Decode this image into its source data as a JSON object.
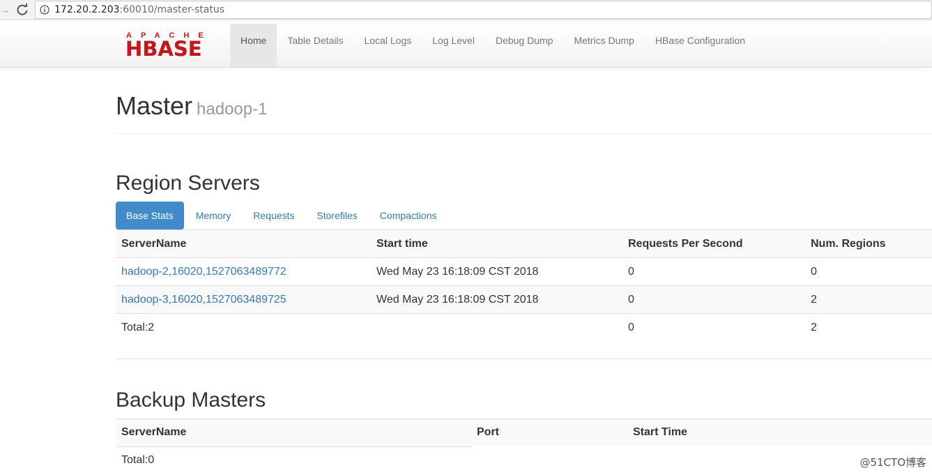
{
  "browser": {
    "url_host": "172.20.2.203",
    "url_rest": ":60010/master-status"
  },
  "logo": {
    "top": "APACHE",
    "main": "HBASE"
  },
  "nav": {
    "items": [
      {
        "label": "Home",
        "active": true
      },
      {
        "label": "Table Details"
      },
      {
        "label": "Local Logs"
      },
      {
        "label": "Log Level"
      },
      {
        "label": "Debug Dump"
      },
      {
        "label": "Metrics Dump"
      },
      {
        "label": "HBase Configuration"
      }
    ]
  },
  "page": {
    "title": "Master",
    "subtitle": "hadoop-1"
  },
  "region_servers": {
    "title": "Region Servers",
    "tabs": [
      {
        "label": "Base Stats",
        "active": true
      },
      {
        "label": "Memory"
      },
      {
        "label": "Requests"
      },
      {
        "label": "Storefiles"
      },
      {
        "label": "Compactions"
      }
    ],
    "columns": [
      "ServerName",
      "Start time",
      "Requests Per Second",
      "Num. Regions"
    ],
    "rows": [
      [
        "hadoop-2,16020,1527063489772",
        "Wed May 23 16:18:09 CST 2018",
        "0",
        "0"
      ],
      [
        "hadoop-3,16020,1527063489725",
        "Wed May 23 16:18:09 CST 2018",
        "0",
        "2"
      ]
    ],
    "total": [
      "Total:2",
      "",
      "0",
      "2"
    ]
  },
  "backup_masters": {
    "title": "Backup Masters",
    "columns": [
      "ServerName",
      "Port",
      "Start Time"
    ],
    "total": "Total:0"
  },
  "watermark": "@51CTO博客",
  "colors": {
    "link": "#337ab7",
    "active_tab": "#428bca",
    "logo_red": "#c4161c"
  }
}
